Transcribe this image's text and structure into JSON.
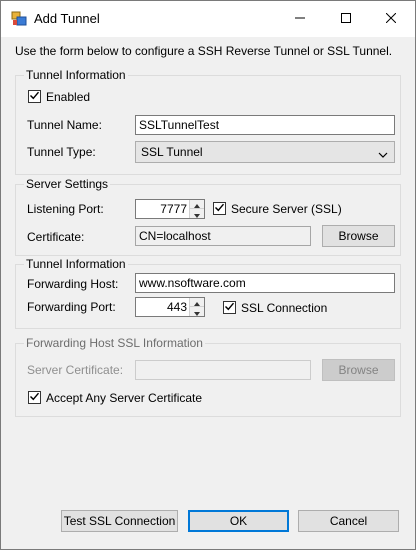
{
  "window": {
    "title": "Add Tunnel"
  },
  "intro": "Use the form below to configure a SSH Reverse Tunnel or SSL Tunnel.",
  "tunnel_info": {
    "title": "Tunnel Information",
    "enabled_label": "Enabled",
    "enabled": true,
    "name_label": "Tunnel Name:",
    "name_value": "SSLTunnelTest",
    "type_label": "Tunnel Type:",
    "type_value": "SSL Tunnel"
  },
  "server_settings": {
    "title": "Server Settings",
    "port_label": "Listening Port:",
    "port_value": "7777",
    "secure_label": "Secure Server (SSL)",
    "secure": true,
    "cert_label": "Certificate:",
    "cert_value": "CN=localhost",
    "browse_label": "Browse"
  },
  "forwarding": {
    "title": "Tunnel Information",
    "host_label": "Forwarding Host:",
    "host_value": "www.nsoftware.com",
    "port_label": "Forwarding Port:",
    "port_value": "443",
    "ssl_label": "SSL Connection",
    "ssl": true
  },
  "fwd_ssl": {
    "title": "Forwarding Host SSL Information",
    "cert_label": "Server Certificate:",
    "cert_value": "",
    "browse_label": "Browse",
    "accept_label": "Accept Any Server Certificate",
    "accept": true
  },
  "buttons": {
    "test": "Test SSL Connection",
    "ok": "OK",
    "cancel": "Cancel"
  },
  "icons": {
    "app": "app-window-icon",
    "minimize": "minimize-icon",
    "maximize": "maximize-icon",
    "close": "close-icon",
    "check": "checkmark-icon",
    "dropdown": "chevron-down-icon",
    "spin_up": "spin-up-icon",
    "spin_down": "spin-down-icon"
  },
  "colors": {
    "accent": "#0078d7",
    "dialog_bg": "#f0f0f0"
  }
}
